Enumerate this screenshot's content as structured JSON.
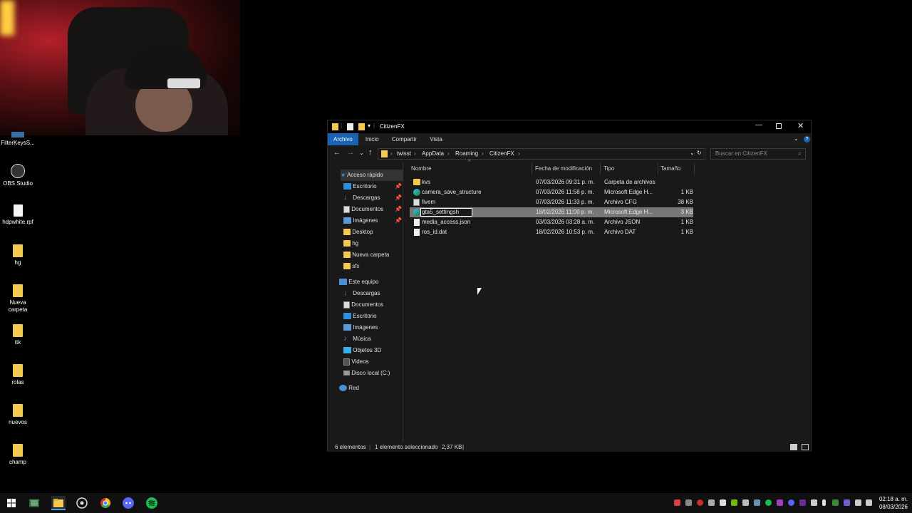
{
  "desktop": {
    "icons": [
      {
        "label": "FilterKeysS...",
        "icon": "app-icon"
      },
      {
        "label": "OBS Studio",
        "icon": "obs-icon"
      },
      {
        "label": "hdpwhite.rpf",
        "icon": "file-icon"
      },
      {
        "label": "hg",
        "icon": "folder-icon"
      },
      {
        "label": "Nueva carpeta",
        "icon": "folder-icon"
      },
      {
        "label": "ttk",
        "icon": "folder-icon"
      },
      {
        "label": "rolas",
        "icon": "folder-icon"
      },
      {
        "label": "nuevos",
        "icon": "folder-icon"
      },
      {
        "label": "champ",
        "icon": "folder-icon"
      }
    ]
  },
  "explorer": {
    "title": "CitizenFX",
    "ribbon_tabs": [
      "Archivo",
      "Inicio",
      "Compartir",
      "Vista"
    ],
    "breadcrumb": [
      "twisst",
      "AppData",
      "Roaming",
      "CitizenFX"
    ],
    "search_placeholder": "Buscar en CitizenFX",
    "nav": {
      "quick_access": "Acceso rápido",
      "quick_items": [
        "Escritorio",
        "Descargas",
        "Documentos",
        "Imágenes",
        "Desktop",
        "hg",
        "Nueva carpeta",
        "sfx"
      ],
      "this_pc": "Este equipo",
      "pc_items": [
        "Descargas",
        "Documentos",
        "Escritorio",
        "Imágenes",
        "Música",
        "Objetos 3D",
        "Videos",
        "Disco local (C:)"
      ],
      "network": "Red"
    },
    "columns": [
      "Nombre",
      "Fecha de modificación",
      "Tipo",
      "Tamaño"
    ],
    "files": [
      {
        "name": "kvs",
        "date": "07/03/2026 09:31 p. m.",
        "type": "Carpeta de archivos",
        "size": ""
      },
      {
        "name": "camera_save_structure",
        "date": "07/03/2026 11:58 p. m.",
        "type": "Microsoft Edge H...",
        "size": "1 KB"
      },
      {
        "name": "fivem",
        "date": "07/03/2026 11:33 p. m.",
        "type": "Archivo CFG",
        "size": "38 KB"
      },
      {
        "name": "gta5_settingsh",
        "date": "18/02/2026 11:00 p. m.",
        "type": "Microsoft Edge H...",
        "size": "3 KB"
      },
      {
        "name": "media_access.json",
        "date": "03/03/2026 03:28 a. m.",
        "type": "Archivo JSON",
        "size": "1 KB"
      },
      {
        "name": "ros_id.dat",
        "date": "18/02/2026 10:53 p. m.",
        "type": "Archivo DAT",
        "size": "1 KB"
      }
    ],
    "status": {
      "count": "6 elementos",
      "selection": "1 elemento seleccionado",
      "selection_size": "2,37 KB"
    }
  },
  "taskbar": {
    "time": "02:18 a. m.",
    "date": "08/03/2026"
  }
}
